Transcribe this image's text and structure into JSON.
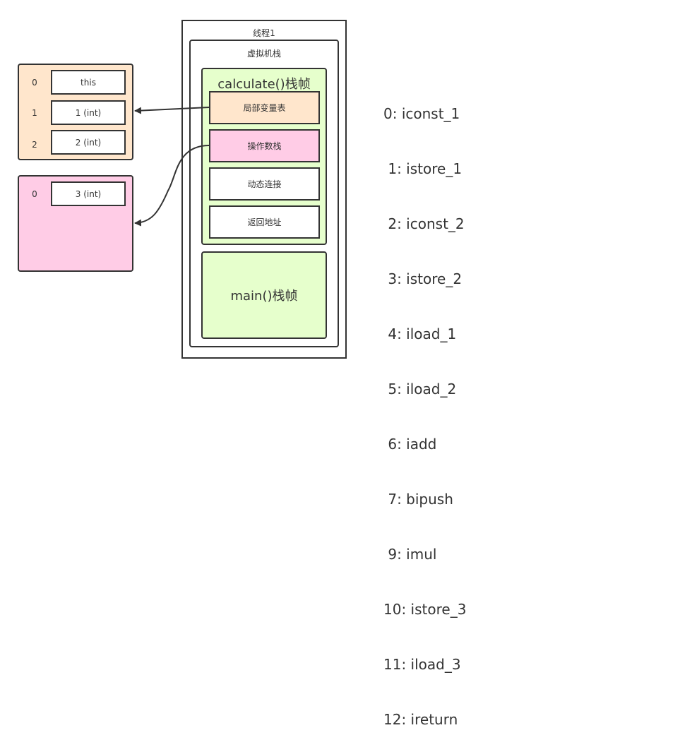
{
  "thread": {
    "title": "线程1",
    "vm_stack": {
      "title": "虚拟机栈",
      "frames": {
        "calculate": {
          "title": "calculate()栈帧",
          "parts": {
            "local_vars": "局部变量表",
            "operand_stack": "操作数栈",
            "dynamic_linking": "动态连接",
            "return_address": "返回地址"
          }
        },
        "main": {
          "title": "main()栈帧"
        }
      }
    }
  },
  "local_variable_table": {
    "slots": [
      {
        "index": "0",
        "value": "this"
      },
      {
        "index": "1",
        "value": "1 (int)"
      },
      {
        "index": "2",
        "value": "2 (int)"
      }
    ]
  },
  "operand_stack": {
    "slots": [
      {
        "index": "0",
        "value": "3 (int)"
      }
    ]
  },
  "bytecode": [
    "0: iconst_1",
    " 1: istore_1",
    " 2: iconst_2",
    " 3: istore_2",
    " 4: iload_1",
    " 5: iload_2",
    " 6: iadd",
    " 7: bipush",
    " 9: imul",
    "10: istore_3",
    "11: iload_3",
    "12: ireturn"
  ],
  "colors": {
    "local_vars_fill": "#ffe6cc",
    "operand_stack_fill": "#ffcce6",
    "frame_fill": "#e6ffcc",
    "stroke": "#333333"
  }
}
